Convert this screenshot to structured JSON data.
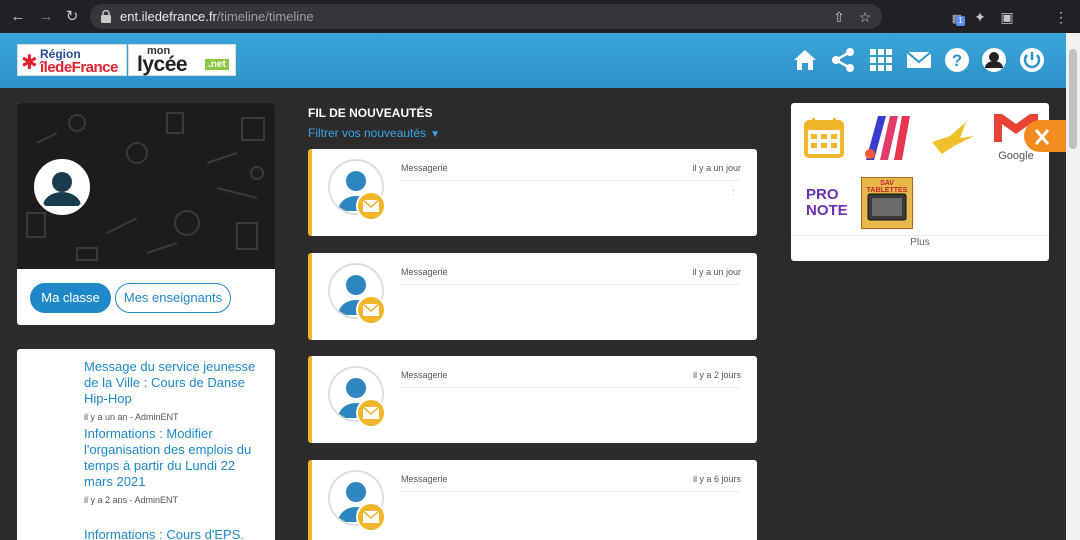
{
  "browser": {
    "url_domain": "ent.iledefrance.fr",
    "url_path": "/timeline/timeline",
    "ext_badge": "1"
  },
  "header": {
    "region_line1": "Région",
    "region_line2": "îledeFrance",
    "site_small": "mon",
    "site_name": "lycée",
    "site_tld": ".net"
  },
  "profile": {
    "button_class": "Ma classe",
    "button_teachers": "Mes enseignants"
  },
  "news": [
    {
      "title": "Message du service jeunesse de la Ville : Cours de Danse Hip-Hop",
      "meta": "il y a un an - AdminENT"
    },
    {
      "title": "Informations : Modifier l'organisation des emplois du temps à partir du Lundi 22 mars 2021",
      "meta": "il y a 2 ans - AdminENT"
    },
    {
      "title": "Informations : Cours d'EPS.",
      "meta": ""
    }
  ],
  "feed": {
    "title": "FIL DE NOUVEAUTÉS",
    "filter": "Filtrer vos nouveautés",
    "items": [
      {
        "app": "Messagerie",
        "time": "il y a un jour",
        "extra": ":"
      },
      {
        "app": "Messagerie",
        "time": "il y a un jour",
        "extra": ""
      },
      {
        "app": "Messagerie",
        "time": "il y a 2 jours",
        "extra": ""
      },
      {
        "app": "Messagerie",
        "time": "il y a 6 jours",
        "extra": ""
      }
    ]
  },
  "apps": {
    "gmail_label": "Google",
    "pronote_line1": "PRO",
    "pronote_line2": "NOTE",
    "sav_label": "SAV TABLETTES",
    "more": "Plus"
  },
  "colors": {
    "header_blue": "#3aa4d8",
    "accent_blue": "#1e88c8",
    "card_accent": "#f0b52a",
    "tools_orange": "#f38b1e"
  }
}
